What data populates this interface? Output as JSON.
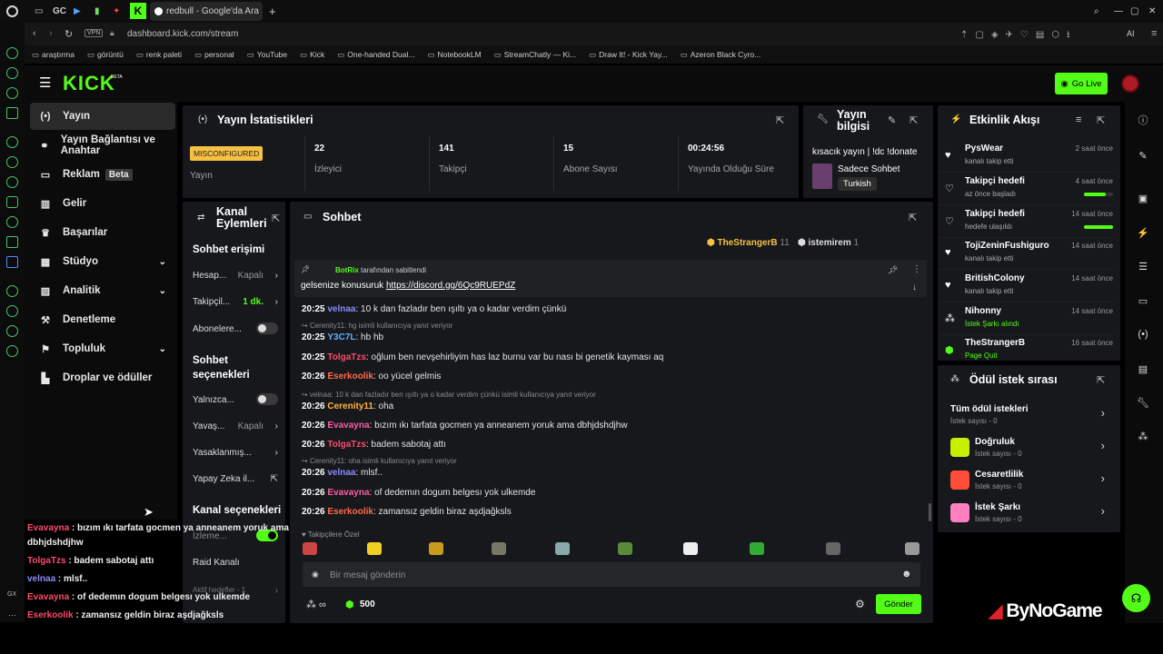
{
  "browser": {
    "tabs": [
      {
        "label": "GC"
      },
      {
        "label": "redbull - Google'da Ara"
      }
    ],
    "address": "dashboard.kick.com/stream",
    "vpn": "VPN",
    "ai_label": "AI",
    "bookmarks": [
      "araştırma",
      "görüntü",
      "renk paleti",
      "personal",
      "YouTube",
      "Kick",
      "One-handed Dual...",
      "NotebookLM",
      "StreamChatly — Ki...",
      "Draw It! - Kick Yay...",
      "Azeron Black Cyro..."
    ]
  },
  "kick": {
    "logo": "KICK",
    "beta_tag": "BETA",
    "go_live": "Go Live"
  },
  "sidebar": {
    "items": [
      {
        "label": "Yayın",
        "icon": "broadcast-icon"
      },
      {
        "label": "Yayın Bağlantısı ve Anahtar",
        "icon": "link-icon"
      },
      {
        "label": "Reklam",
        "badge": "Beta",
        "icon": "ad-icon"
      },
      {
        "label": "Gelir",
        "icon": "revenue-icon"
      },
      {
        "label": "Başarılar",
        "icon": "trophy-icon"
      },
      {
        "label": "Stüdyo",
        "icon": "studio-icon"
      },
      {
        "label": "Analitik",
        "icon": "analytics-icon"
      },
      {
        "label": "Denetleme",
        "icon": "hammer-icon"
      },
      {
        "label": "Topluluk",
        "icon": "community-icon"
      },
      {
        "label": "Droplar ve ödüller",
        "icon": "drops-icon"
      }
    ]
  },
  "stats": {
    "title": "Yayın İstatistikleri",
    "status_badge": "MISCONFIGURED",
    "status_label": "Yayın",
    "items": [
      {
        "value": "22",
        "label": "İzleyici"
      },
      {
        "value": "141",
        "label": "Takipçi"
      },
      {
        "value": "15",
        "label": "Abone Sayısı"
      },
      {
        "value": "00:24:56",
        "label": "Yayında Olduğu Süre"
      }
    ]
  },
  "stream_info": {
    "title": "Yayın bilgisi",
    "stream_title": "kısacık yayın | !dc !donate",
    "category": "Sadece Sohbet",
    "language": "Turkish"
  },
  "channel_actions": {
    "title": "Kanal Eylemleri",
    "chat_access_title": "Sohbet erişimi",
    "items": [
      {
        "label": "Hesap...",
        "value": "Kapalı"
      },
      {
        "label": "Takipçil...",
        "value": "1 dk."
      },
      {
        "label": "Abonelere..."
      }
    ],
    "chat_options_title": "Sohbet seçenekleri",
    "options": [
      {
        "label": "Yalnızca..."
      },
      {
        "label": "Yavaş...",
        "value": "Kapalı"
      },
      {
        "label": "Yasaklanmış..."
      },
      {
        "label": "Yapay Zeka il..."
      }
    ],
    "channel_options_title": "Kanal seçenekleri",
    "channel_items": [
      {
        "label": "İzleme..."
      },
      {
        "label": "Raid Kanalı"
      },
      {
        "label": "Aktif hedefler - 1"
      }
    ]
  },
  "chat": {
    "title": "Sohbet",
    "top_users": [
      {
        "name": "TheStrangerB",
        "count": "11"
      },
      {
        "name": "istemirem",
        "count": "1"
      }
    ],
    "pinned_by": "BotRix",
    "pinned_suffix": "tarafından sabitlendi",
    "pinned_text": "gelsenize konusuruk",
    "pinned_link": "https://discord.gg/6Qc9RUEPdZ",
    "messages": [
      {
        "time": "20:25",
        "user": "velnaa",
        "color": "#8a8aff",
        "text": ": 10 k dan fazladır ben ışıltı ya o kadar verdim çünkü"
      },
      {
        "reply": "Cerenity11: hg isimli kullanıcıya yanıt veriyor"
      },
      {
        "time": "20:25",
        "user": "Y3C7L",
        "color": "#5fb3ff",
        "text": ": hb hb"
      },
      {
        "time": "20:25",
        "user": "TolgaTzs",
        "color": "#ff4b6e",
        "text": ": oğlum ben nevşehirliyim has laz burnu var bu nası bi genetik kayması aq"
      },
      {
        "time": "20:26",
        "user": "Eserkoolik",
        "color": "#ff6a4d",
        "text": ": oo yücel gelmis"
      },
      {
        "reply": "velnaa: 10 k dan fazladır ben ışıltı ya o kadar verdim çünkü isimli kullanıcıya yanıt veriyor"
      },
      {
        "time": "20:26",
        "user": "Cerenity11",
        "color": "#ffb347",
        "text": ": oha"
      },
      {
        "time": "20:26",
        "user": "Evavayna",
        "color": "#ff5ca8",
        "text": ": bızım ıkı tarfata gocmen ya anneanem yoruk ama dbhjdshdjhw"
      },
      {
        "time": "20:26",
        "user": "TolgaTzs",
        "color": "#ff4b6e",
        "text": ": badem sabotaj attı"
      },
      {
        "reply": "Cerenity11: oha isimli kullanıcıya yanıt veriyor"
      },
      {
        "time": "20:26",
        "user": "velnaa",
        "color": "#8a8aff",
        "text": ": mlsf.."
      },
      {
        "time": "20:26",
        "user": "Evavayna",
        "color": "#ff5ca8",
        "text": ": of dedemın dogum belgesı yok ulkemde"
      },
      {
        "time": "20:26",
        "user": "Eserkoolik",
        "color": "#ff6a4d",
        "text": ": zamansız geldin biraz aşdjağksls"
      }
    ],
    "followers_only": "Takipçilere Özel",
    "input_placeholder": "Bir mesaj gönderin",
    "points": "500",
    "send": "Gönder"
  },
  "activity": {
    "title": "Etkinlik Akışı",
    "items": [
      {
        "name": "PysWear",
        "sub": "kanalı takip etti",
        "time": "2 saat önce"
      },
      {
        "name": "Takipçi hedefi",
        "sub": "az önce başladı",
        "time": "4 saat önce",
        "progress": 0.75
      },
      {
        "name": "Takipçi hedefi",
        "sub": "hedefe ulaşıldı",
        "time": "14 saat önce",
        "progress": 1.0
      },
      {
        "name": "TojiZeninFushiguro",
        "sub": "kanalı takip etti",
        "time": "14 saat önce"
      },
      {
        "name": "BritishColony",
        "sub": "kanalı takip etti",
        "time": "14 saat önce"
      },
      {
        "name": "Nihonny",
        "sub": "İstek Şarkı alındı",
        "time": "14 saat önce"
      },
      {
        "name": "TheStrangerB",
        "sub": "Page Quit",
        "time": "16 saat önce"
      }
    ]
  },
  "rewards": {
    "title": "Ödül istek sırası",
    "all_title": "Tüm ödül istekleri",
    "all_sub": "İstek sayısı - 0",
    "items": [
      {
        "name": "Doğruluk",
        "sub": "İstek sayısı - 0",
        "color": "#c6f000"
      },
      {
        "name": "Cesaretlilik",
        "sub": "İstek sayısı - 0",
        "color": "#ff4d3a"
      },
      {
        "name": "İstek Şarkı",
        "sub": "İstek sayısı - 0",
        "color": "#ff7fc0"
      }
    ]
  },
  "overlay_chat": [
    {
      "user": "Evavayna",
      "color": "#ff4b6e",
      "text": " : bızım ıkı tarfata gocmen ya anneanem yoruk ama"
    },
    {
      "text": "dbhjdshdjhw"
    },
    {
      "user": "TolgaTzs",
      "color": "#ff4b6e",
      "text": " : badem sabotaj attı"
    },
    {
      "user": "velnaa",
      "color": "#8a8aff",
      "text": " : mlsf.."
    },
    {
      "user": "Evavayna",
      "color": "#ff4b6e",
      "text": " : of dedemın dogum belgesı yok ulkemde"
    },
    {
      "user": "Eserkoolik",
      "color": "#ff4b6e",
      "text": " : zamansız geldin biraz aşdjağksls"
    }
  ],
  "watermark": "ByNoGame",
  "colors": {
    "accent": "#53fc18",
    "panel": "#16181b",
    "bg": "#000000"
  }
}
